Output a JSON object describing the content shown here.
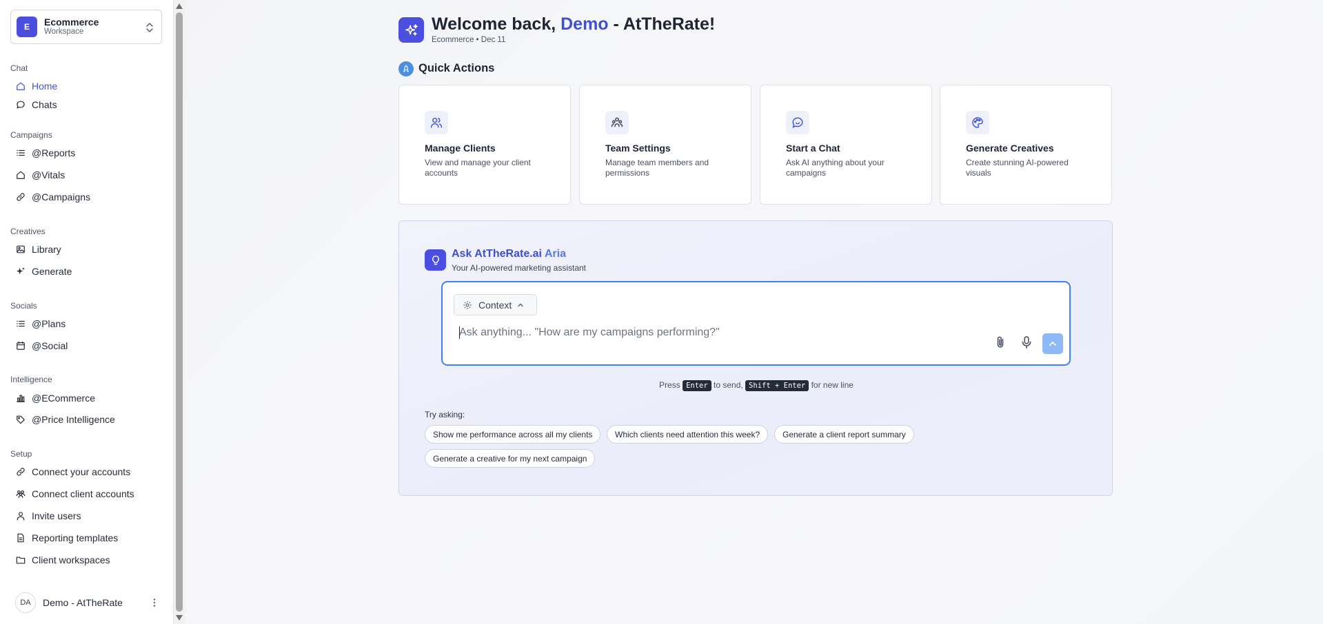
{
  "workspace": {
    "initial": "E",
    "name": "Ecommerce",
    "subtitle": "Workspace"
  },
  "sidebar": {
    "sections": {
      "chat": "Chat",
      "campaigns": "Campaigns",
      "creatives": "Creatives",
      "socials": "Socials",
      "intelligence": "Intelligence",
      "setup": "Setup"
    },
    "items": {
      "home": "Home",
      "chats": "Chats",
      "reports": "@Reports",
      "vitals": "@Vitals",
      "campaigns": "@Campaigns",
      "library": "Library",
      "generate": "Generate",
      "plans": "@Plans",
      "social": "@Social",
      "ecommerce": "@ECommerce",
      "price_intelligence": "@Price Intelligence",
      "connect_accounts": "Connect your accounts",
      "connect_client_accounts": "Connect client accounts",
      "invite_users": "Invite users",
      "reporting_templates": "Reporting templates",
      "client_workspaces": "Client workspaces"
    },
    "user": {
      "initials": "DA",
      "name": "Demo - AtTheRate"
    }
  },
  "header": {
    "welcome_prefix": "Welcome back, ",
    "welcome_name": "Demo",
    "welcome_suffix": " - AtTheRate!",
    "subtitle": "Ecommerce • Dec 11"
  },
  "quick_actions": {
    "title": "Quick Actions",
    "cards": [
      {
        "title": "Manage Clients",
        "desc": "View and manage your client accounts"
      },
      {
        "title": "Team Settings",
        "desc": "Manage team members and permissions"
      },
      {
        "title": "Start a Chat",
        "desc": "Ask AI anything about your campaigns"
      },
      {
        "title": "Generate Creatives",
        "desc": "Create stunning AI-powered visuals"
      }
    ]
  },
  "aria": {
    "title_main": "Ask AtTheRate.ai",
    "title_accent": " Aria",
    "subtitle": "Your AI-powered marketing assistant",
    "context_label": "Context",
    "input_placeholder": "Ask anything... \"How are my campaigns performing?\"",
    "input_value": "",
    "hint_press": "Press ",
    "hint_enter": "Enter",
    "hint_to_send": " to send, ",
    "hint_shift_enter": "Shift + Enter",
    "hint_new_line": " for new line",
    "try_label": "Try asking:",
    "suggestions": [
      "Show me performance across all my clients",
      "Which clients need attention this week?",
      "Generate a client report summary",
      "Generate a creative for my next campaign"
    ]
  },
  "colors": {
    "accent": "#4b4fe0",
    "link_blue": "#3c56e0",
    "focus_border": "#3b82f6",
    "send_button": "#8fb8f6"
  }
}
